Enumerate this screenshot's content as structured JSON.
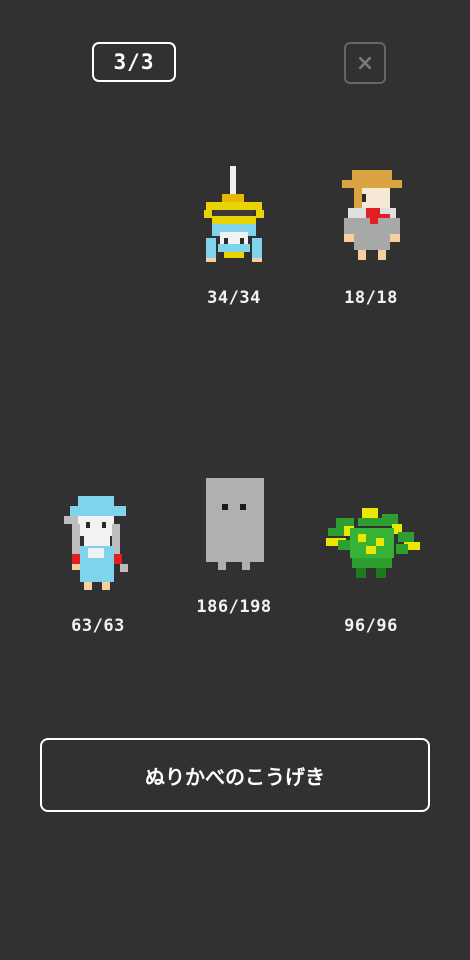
{
  "header": {
    "page_counter": "3/3",
    "close_label": "×",
    "close_icon": "close-icon"
  },
  "party": {
    "members": [
      {
        "name_icon": "yellow-mage-bust-icon",
        "hp": "34/34"
      },
      {
        "name_icon": "farmer-straw-hat-icon",
        "hp": "18/18"
      },
      {
        "name_icon": "blue-hooded-wizard-icon",
        "hp": "63/63"
      },
      {
        "name_icon": "gray-nurikabe-wall-icon",
        "hp": "186/198"
      },
      {
        "name_icon": "green-multi-head-hydra-icon",
        "hp": "96/96"
      }
    ]
  },
  "action": {
    "label": "ぬりかべのこうげき"
  },
  "colors": {
    "background": "#313131",
    "text": "#ffffff",
    "close_border": "#666666"
  }
}
